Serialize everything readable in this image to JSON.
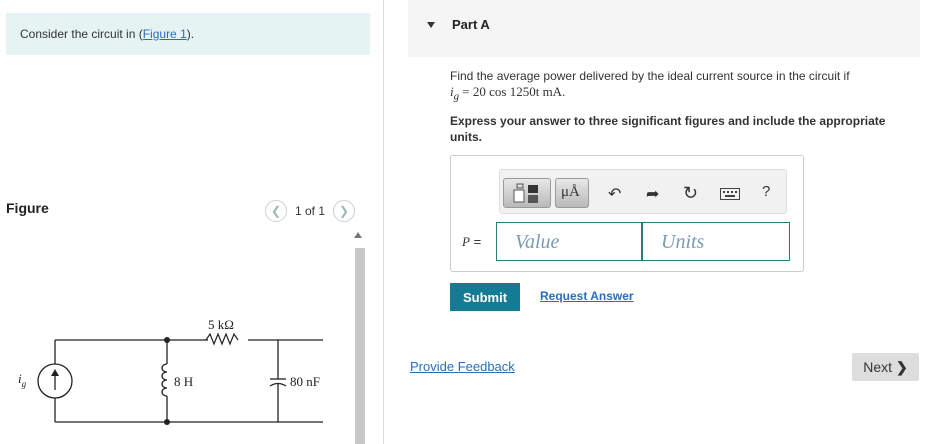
{
  "left": {
    "intro_prefix": "Consider the circuit in (",
    "intro_link": "Figure 1",
    "intro_suffix": ").",
    "figure_label": "Figure",
    "pager_text": "1 of 1",
    "prev_icon": "chevron-left-icon",
    "next_icon": "chevron-right-icon",
    "circuit": {
      "source_label": "i",
      "source_sub": "g",
      "inductor_label": "8 H",
      "resistor_label": "5 kΩ",
      "capacitor_label": "80 nF"
    }
  },
  "part": {
    "title": "Part A",
    "question_line1": "Find the average power delivered by the ideal current source in the circuit if",
    "question_math_var": "i",
    "question_math_sub": "g",
    "question_math_rest": " = 20 cos 1250t mA.",
    "instruction": "Express your answer to three significant figures and include the appropriate units."
  },
  "answer": {
    "toolbar": {
      "template_icon": "templates-icon",
      "units_symbol": "μÅ",
      "undo_icon": "undo-icon",
      "redo_icon": "redo-icon",
      "reset_icon": "reset-icon",
      "keyboard_icon": "keyboard-icon",
      "help_symbol": "?"
    },
    "variable": "P",
    "equals": " =",
    "value_placeholder": "Value",
    "units_placeholder": "Units"
  },
  "actions": {
    "submit_label": "Submit",
    "request_answer_label": "Request Answer",
    "feedback_label": "Provide Feedback",
    "next_label": "Next",
    "next_glyph": "❯"
  }
}
